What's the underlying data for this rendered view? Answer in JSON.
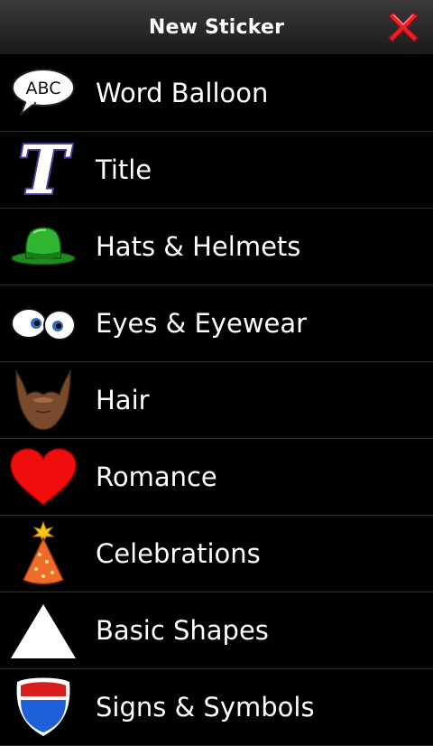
{
  "header": {
    "title": "New Sticker",
    "close_icon": "close-icon"
  },
  "colors": {
    "background": "#000000",
    "titlebar": "#2a2a2a",
    "divider": "#2e2e2e",
    "close_red": "#e8212b"
  },
  "items": [
    {
      "label": "Word Balloon",
      "icon": "word-balloon-icon",
      "icon_text": "ABC"
    },
    {
      "label": "Title",
      "icon": "title-icon",
      "icon_text": "T"
    },
    {
      "label": "Hats & Helmets",
      "icon": "hat-icon"
    },
    {
      "label": "Eyes & Eyewear",
      "icon": "eyes-icon"
    },
    {
      "label": "Hair",
      "icon": "beard-icon"
    },
    {
      "label": "Romance",
      "icon": "heart-icon"
    },
    {
      "label": "Celebrations",
      "icon": "party-hat-icon"
    },
    {
      "label": "Basic Shapes",
      "icon": "triangle-icon"
    },
    {
      "label": "Signs & Symbols",
      "icon": "shield-sign-icon"
    }
  ]
}
